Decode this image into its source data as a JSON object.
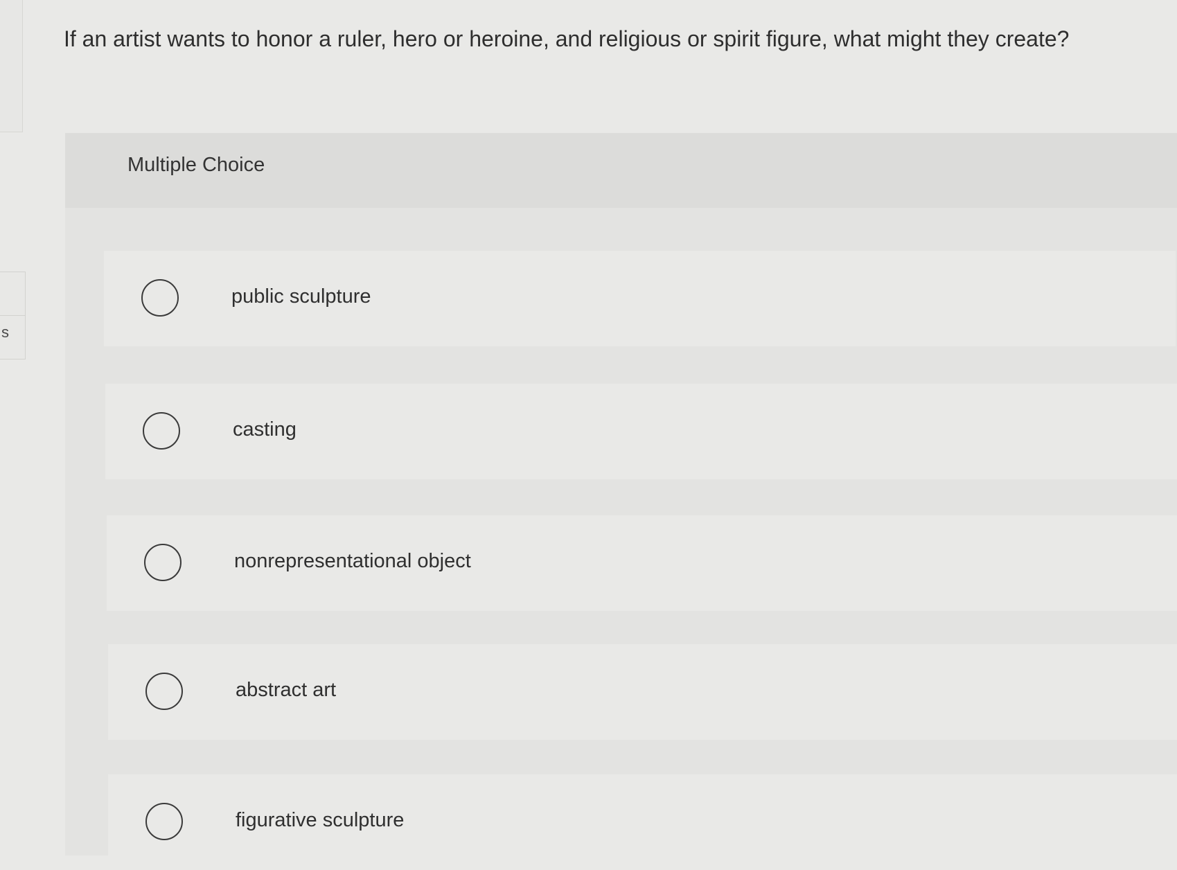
{
  "left_tab": {
    "letter": "s"
  },
  "question": {
    "text": "If an artist wants to honor a ruler, hero or heroine, and religious or spirit figure, what might they create?"
  },
  "multiple_choice": {
    "label": "Multiple Choice",
    "options": [
      {
        "label": "public sculpture",
        "selected": false
      },
      {
        "label": "casting",
        "selected": false
      },
      {
        "label": "nonrepresentational object",
        "selected": false
      },
      {
        "label": "abstract art",
        "selected": false
      },
      {
        "label": "figurative sculpture",
        "selected": false
      }
    ]
  }
}
